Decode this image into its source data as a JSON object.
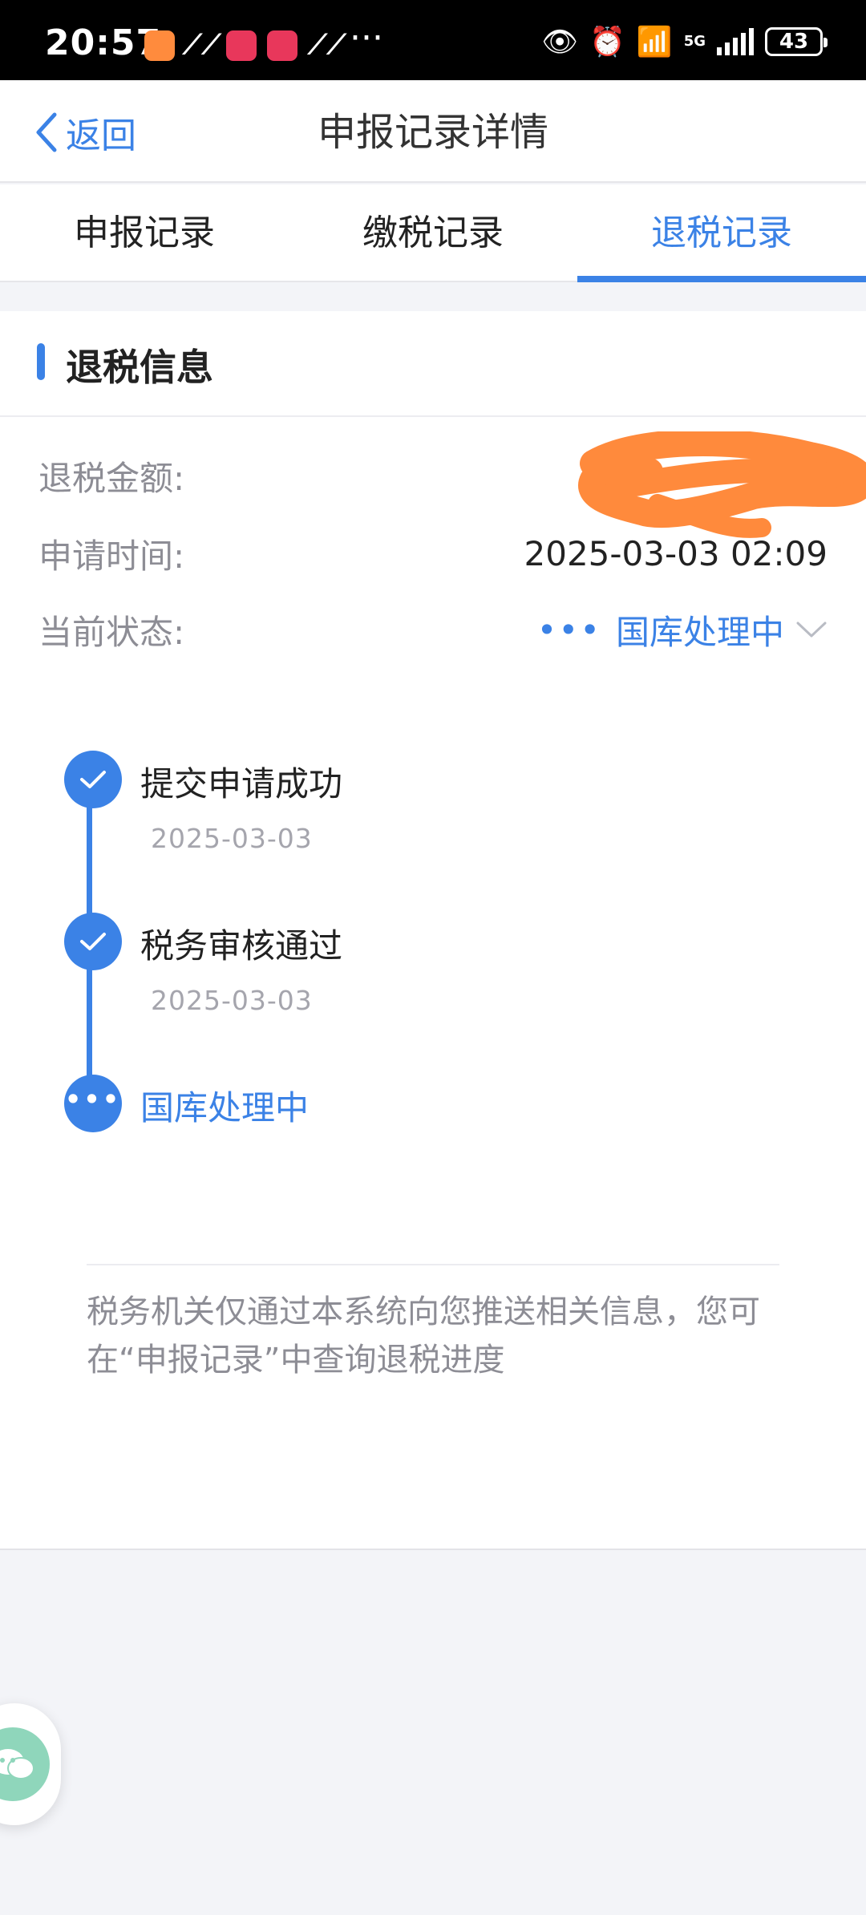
{
  "status_bar": {
    "time": "20:57",
    "network": "5G",
    "battery": "43"
  },
  "header": {
    "back_label": "返回",
    "title": "申报记录详情"
  },
  "tabs": [
    {
      "label": "申报记录",
      "active": false
    },
    {
      "label": "缴税记录",
      "active": false
    },
    {
      "label": "退税记录",
      "active": true
    }
  ],
  "refund": {
    "section_title": "退税信息",
    "amount_label": "退税金额:",
    "amount_value": "",
    "time_label": "申请时间:",
    "time_value": "2025-03-03 02:09",
    "status_label": "当前状态:",
    "status_value": "国库处理中"
  },
  "timeline": [
    {
      "title": "提交申请成功",
      "date": "2025-03-03",
      "state": "done"
    },
    {
      "title": "税务审核通过",
      "date": "2025-03-03",
      "state": "done"
    },
    {
      "title": "国库处理中",
      "date": "",
      "state": "current"
    }
  ],
  "note": "税务机关仅通过本系统向您推送相关信息，您可在“申报记录”中查询退税进度",
  "colors": {
    "accent": "#3b82e6",
    "redaction": "#ff8a3c"
  }
}
